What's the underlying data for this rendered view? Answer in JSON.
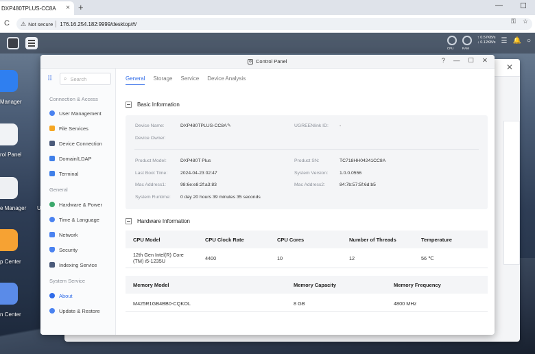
{
  "browser": {
    "tab_title": "DXP480TPLUS-CC8A",
    "tab_close": "×",
    "new_tab": "+",
    "minimize": "—",
    "maximize": "☐",
    "reload_icon": "C",
    "security_label": "Not secure",
    "url": "176.16.254.182:9999/desktop/#/"
  },
  "system_tray": {
    "cpu_label": "CPU",
    "ram_label": "RAM",
    "upload_speed": "↑ 0.57KB/s",
    "download_speed": "↓ 0.12KB/s"
  },
  "desktop": {
    "icons": [
      {
        "label": "Manager"
      },
      {
        "label": "rol Panel"
      },
      {
        "label": "e Manager"
      },
      {
        "label": "p Center"
      },
      {
        "label": "n Center"
      }
    ],
    "stray_label": "U"
  },
  "control_panel": {
    "title": "Control Panel",
    "controls": [
      "?",
      "—",
      "☐",
      "✕"
    ],
    "search_placeholder": "Search",
    "sidebar": {
      "sections": [
        {
          "title": "Connection & Access",
          "items": [
            "User Management",
            "File Services",
            "Device Connection",
            "Domain/LDAP",
            "Terminal"
          ]
        },
        {
          "title": "General",
          "items": [
            "Hardware & Power",
            "Time & Language",
            "Network",
            "Security",
            "Indexing Service"
          ]
        },
        {
          "title": "System Service",
          "items": [
            "About",
            "Update & Restore"
          ]
        }
      ],
      "active_item": "About"
    },
    "tabs": [
      "General",
      "Storage",
      "Service",
      "Device Analysis"
    ],
    "active_tab": "General",
    "basic_info": {
      "heading": "Basic Information",
      "device_name_label": "Device Name:",
      "device_name": "DXP480TPLUS-CC8A",
      "ugreenlink_label": "UGREENlink ID:",
      "ugreenlink_value": "-",
      "device_owner_label": "Device Owner:",
      "product_model_label": "Product Model:",
      "product_model": "DXP480T Plus",
      "product_sn_label": "Product SN:",
      "product_sn": "TC718HH04241CC8A",
      "last_boot_label": "Last Boot Time:",
      "last_boot": "2024-04-23 02:47",
      "system_version_label": "System Version:",
      "system_version": "1.0.0.0556",
      "mac1_label": "Mac Address1:",
      "mac1": "98:6e:e8:2f:a3:83",
      "mac2_label": "Mac Address2:",
      "mac2": "84:7b:57:5f:6d:b5",
      "runtime_label": "System Runtime:",
      "runtime": "0 day 20 hours 39 minutes 35 seconds"
    },
    "hardware_info": {
      "heading": "Hardware Information",
      "cpu_headers": [
        "CPU Model",
        "CPU Clock Rate",
        "CPU Cores",
        "Number of Threads",
        "Temperature"
      ],
      "cpu_row": {
        "model_line1": "12th Gen Intel(R) Core",
        "model_line2": "(TM) i5-1235U",
        "clock": "4400",
        "cores": "10",
        "threads": "12",
        "temperature": "56 ℃"
      },
      "memory_headers": [
        "Memory Model",
        "Memory Capacity",
        "Memory Frequency"
      ],
      "memory_row": {
        "model": "M425R1GB4BB0-CQKOL",
        "capacity": "8 GB",
        "frequency": "4800 MHz"
      }
    }
  }
}
